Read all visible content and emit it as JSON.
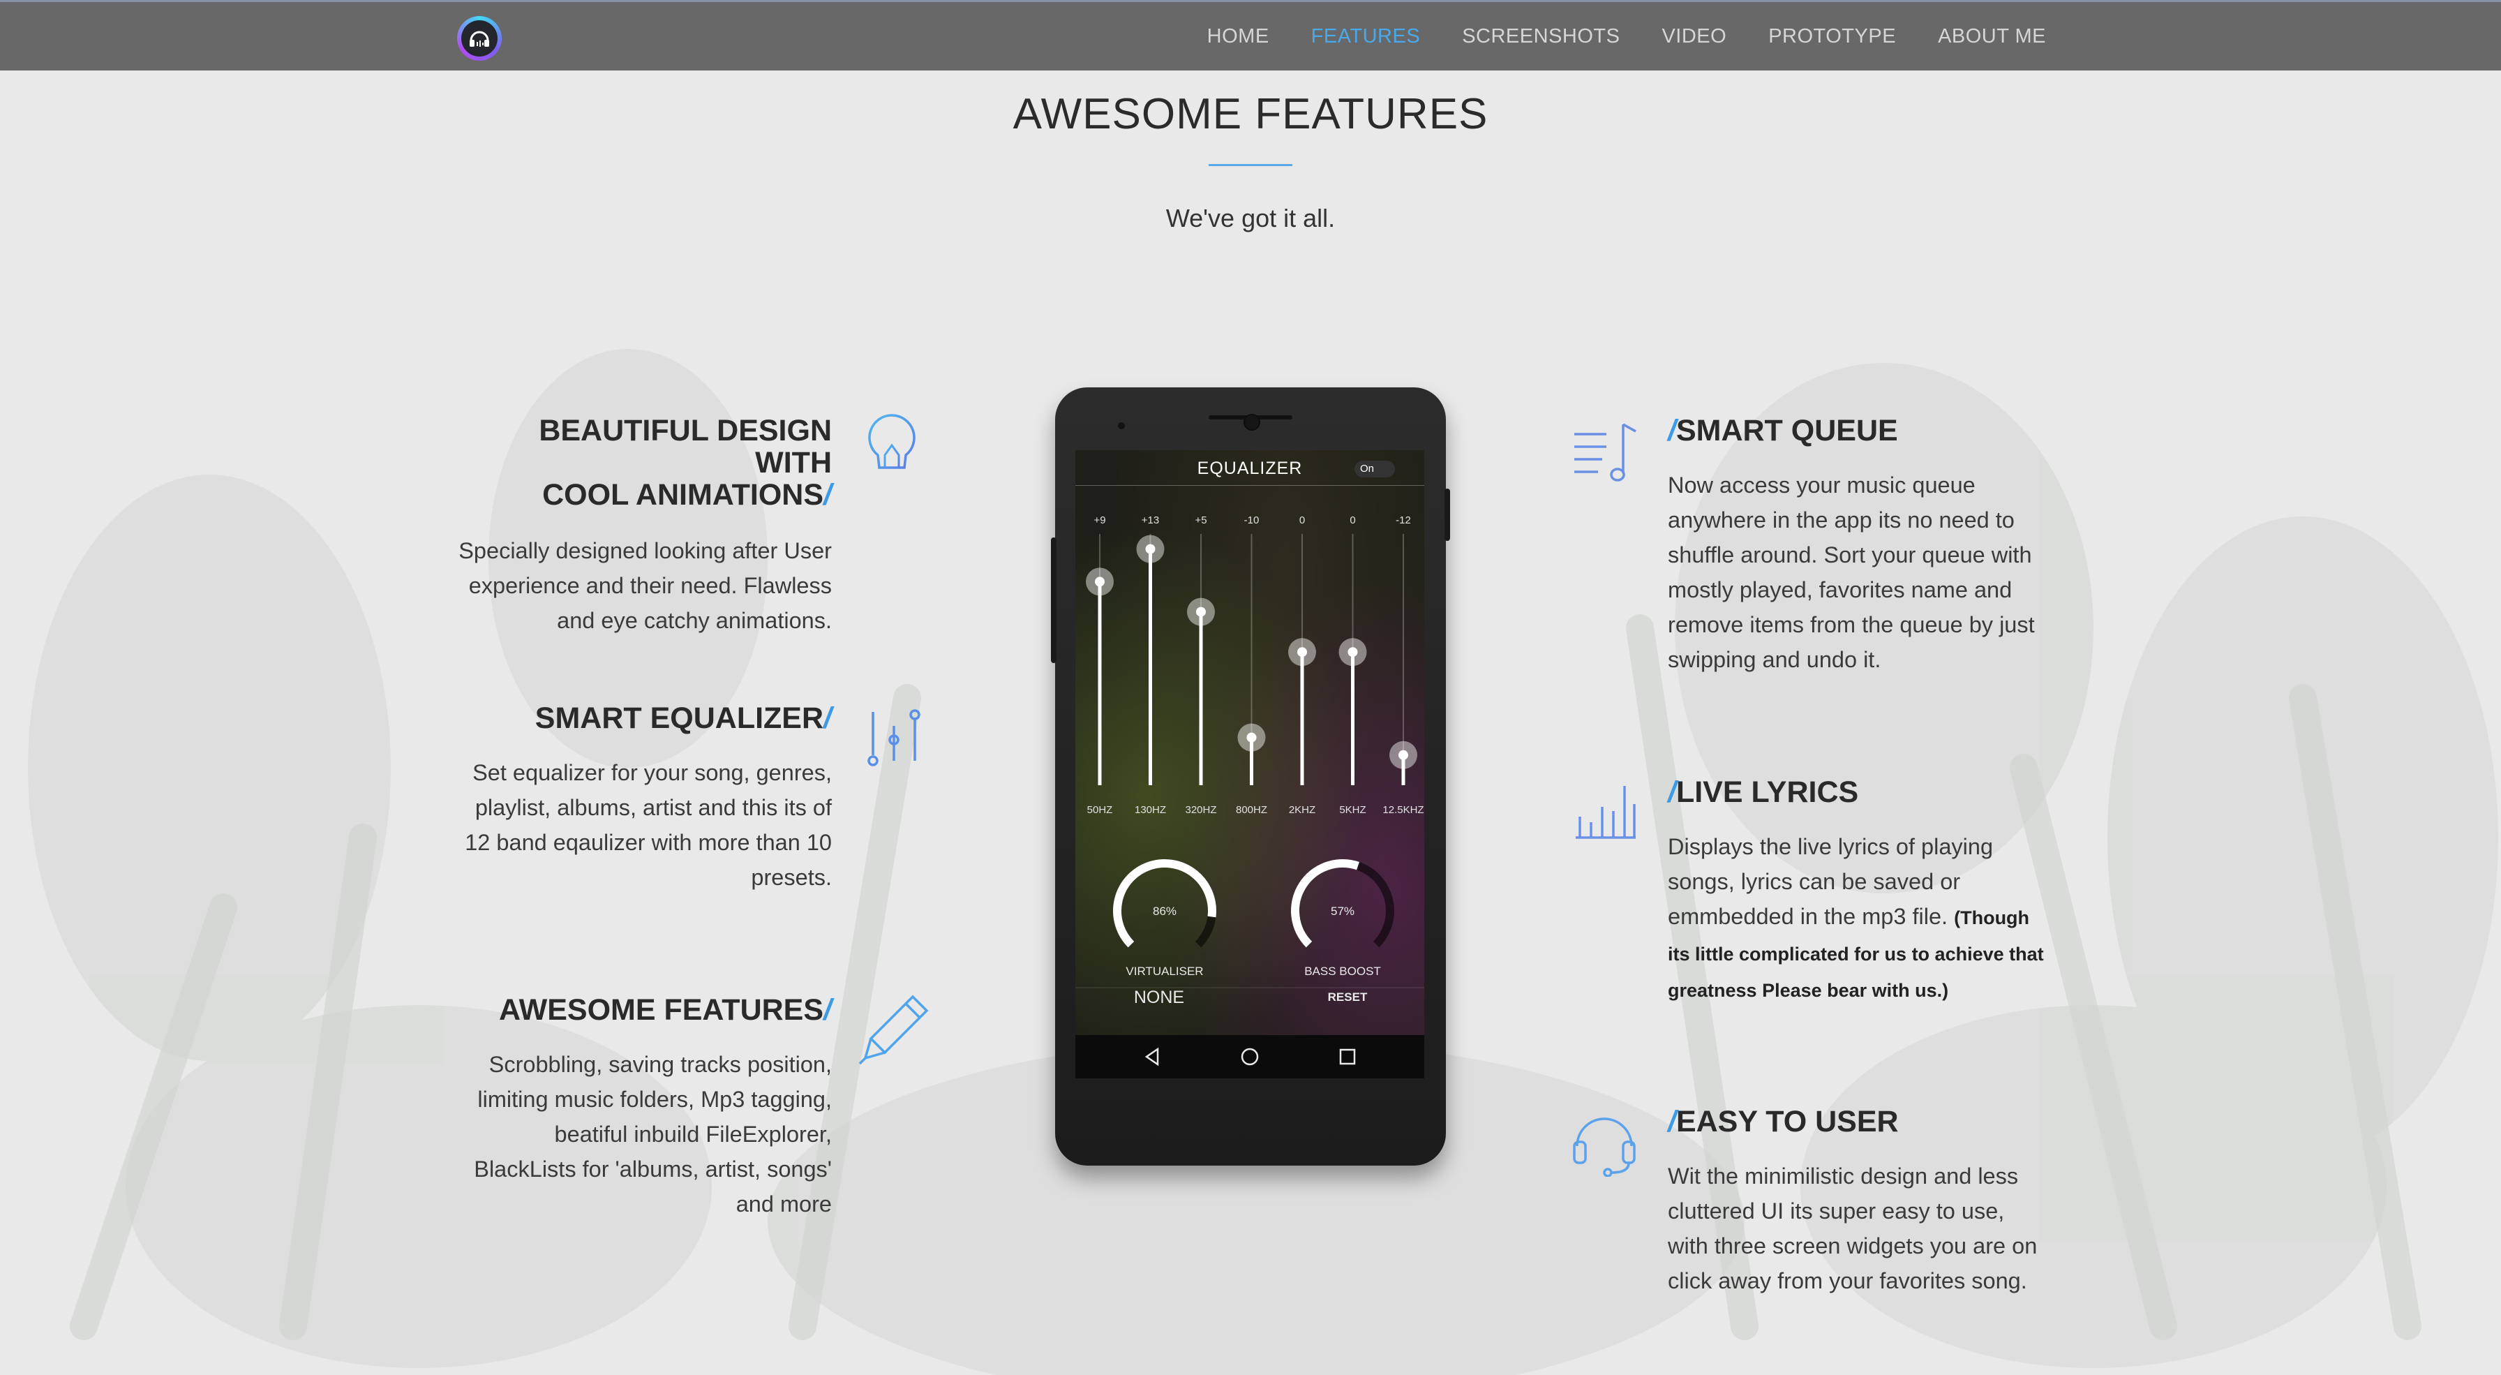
{
  "nav": {
    "logo_icon": "headphones-icon",
    "items": [
      {
        "label": "HOME",
        "active": false
      },
      {
        "label": "FEATURES",
        "active": true
      },
      {
        "label": "SCREENSHOTS",
        "active": false
      },
      {
        "label": "VIDEO",
        "active": false
      },
      {
        "label": "PROTOTYPE",
        "active": false
      },
      {
        "label": "ABOUT ME",
        "active": false
      }
    ],
    "active_color": "#49a9ea"
  },
  "section": {
    "title": "AWESOME FEATURES",
    "subtitle": "We've got it all."
  },
  "left_features": [
    {
      "title_line1": "BEAUTIFUL DESIGN WITH",
      "title_line2": "COOL ANIMATIONS",
      "slash": "/",
      "icon": "lightbulb-icon",
      "text": "Specially designed looking after User experience and their need. Flawless and eye catchy animations."
    },
    {
      "title_line1": "SMART EQUALIZER",
      "slash": "/",
      "icon": "equalizer-sliders-icon",
      "text": "Set equalizer for your song, genres, playlist, albums, artist and this its of 12 band eqaulizer with more than 10 presets."
    },
    {
      "title_line1": "AWESOME FEATURES",
      "slash": "/",
      "icon": "pen-icon",
      "text": "Scrobbling, saving tracks position, limiting music folders, Mp3 tagging, beatiful inbuild FileExplorer, BlackLists for 'albums, artist, songs' and more"
    }
  ],
  "right_features": [
    {
      "title": "SMART QUEUE",
      "slash": "/",
      "icon": "music-queue-icon",
      "text": "Now access your music queue anywhere in the app its no need to shuffle around. Sort your queue with mostly played, favorites name and remove items from the queue by just swipping and undo it."
    },
    {
      "title": "LIVE LYRICS",
      "slash": "/",
      "icon": "bar-chart-icon",
      "text": "Displays the live lyrics of playing songs, lyrics can be saved or emmbedded in the mp3 file.",
      "bold_text": "(Though its little complicated for us to achieve that greatness Please bear with us.)"
    },
    {
      "title": "EASY TO USER",
      "slash": "/",
      "icon": "headset-icon",
      "text": "Wit the minimilistic design and less cluttered UI its super easy to use, with three screen widgets you are on click away from your favorites song."
    }
  ],
  "phone": {
    "eq_title": "EQUALIZER",
    "toggle": "On",
    "bands": [
      {
        "value": "+9",
        "freq": "50HZ",
        "level": 0.81
      },
      {
        "value": "+13",
        "freq": "130HZ",
        "level": 0.94
      },
      {
        "value": "+5",
        "freq": "320HZ",
        "level": 0.69
      },
      {
        "value": "-10",
        "freq": "800HZ",
        "level": 0.19
      },
      {
        "value": "0",
        "freq": "2KHZ",
        "level": 0.53
      },
      {
        "value": "0",
        "freq": "5KHZ",
        "level": 0.53
      },
      {
        "value": "-12",
        "freq": "12.5KHZ",
        "level": 0.12
      }
    ],
    "knobs": [
      {
        "value": "86%",
        "label": "VIRTUALISER",
        "level": 0.86
      },
      {
        "value": "57%",
        "label": "BASS BOOST",
        "level": 0.57
      }
    ],
    "preset": "NONE",
    "reset": "RESET"
  }
}
